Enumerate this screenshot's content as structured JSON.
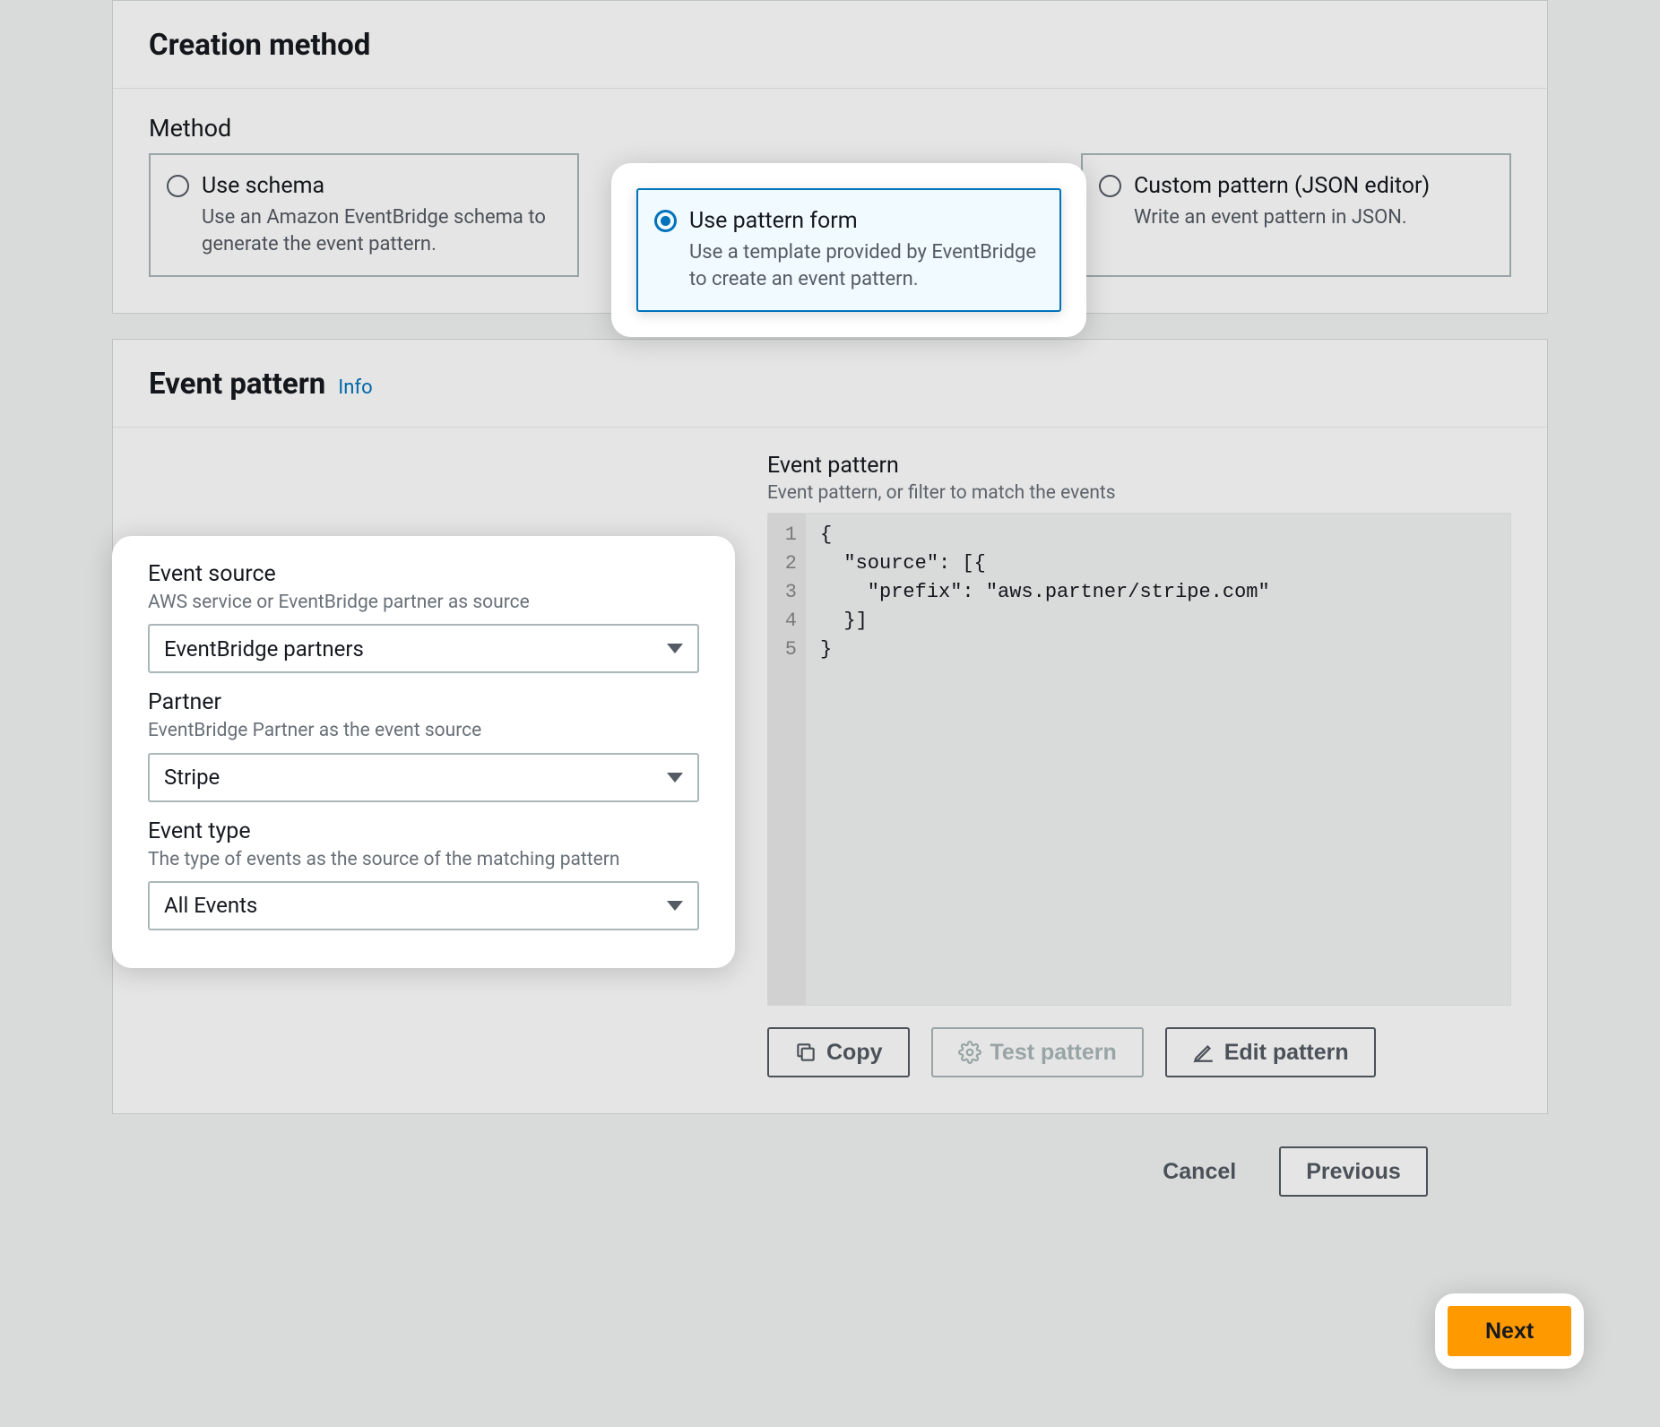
{
  "creation_method": {
    "panel_title": "Creation method",
    "method_label": "Method",
    "options": [
      {
        "title": "Use schema",
        "desc": "Use an Amazon EventBridge schema to generate the event pattern."
      },
      {
        "title": "Use pattern form",
        "desc": "Use a template provided by EventBridge to create an event pattern."
      },
      {
        "title": "Custom pattern (JSON editor)",
        "desc": "Write an event pattern in JSON."
      }
    ]
  },
  "event_pattern": {
    "panel_title": "Event pattern",
    "info_label": "Info",
    "event_source": {
      "label": "Event source",
      "hint": "AWS service or EventBridge partner as source",
      "value": "EventBridge partners"
    },
    "partner": {
      "label": "Partner",
      "hint": "EventBridge Partner as the event source",
      "value": "Stripe"
    },
    "event_type": {
      "label": "Event type",
      "hint": "The type of events as the source of the matching pattern",
      "value": "All Events"
    },
    "pattern_label": "Event pattern",
    "pattern_hint": "Event pattern, or filter to match the events",
    "code_lines": [
      "1",
      "2",
      "3",
      "4",
      "5"
    ],
    "code_text": "{\n  \"source\": [{\n    \"prefix\": \"aws.partner/stripe.com\"\n  }]\n}",
    "buttons": {
      "copy": "Copy",
      "test": "Test pattern",
      "edit": "Edit pattern"
    }
  },
  "wizard": {
    "cancel": "Cancel",
    "previous": "Previous",
    "next": "Next"
  }
}
